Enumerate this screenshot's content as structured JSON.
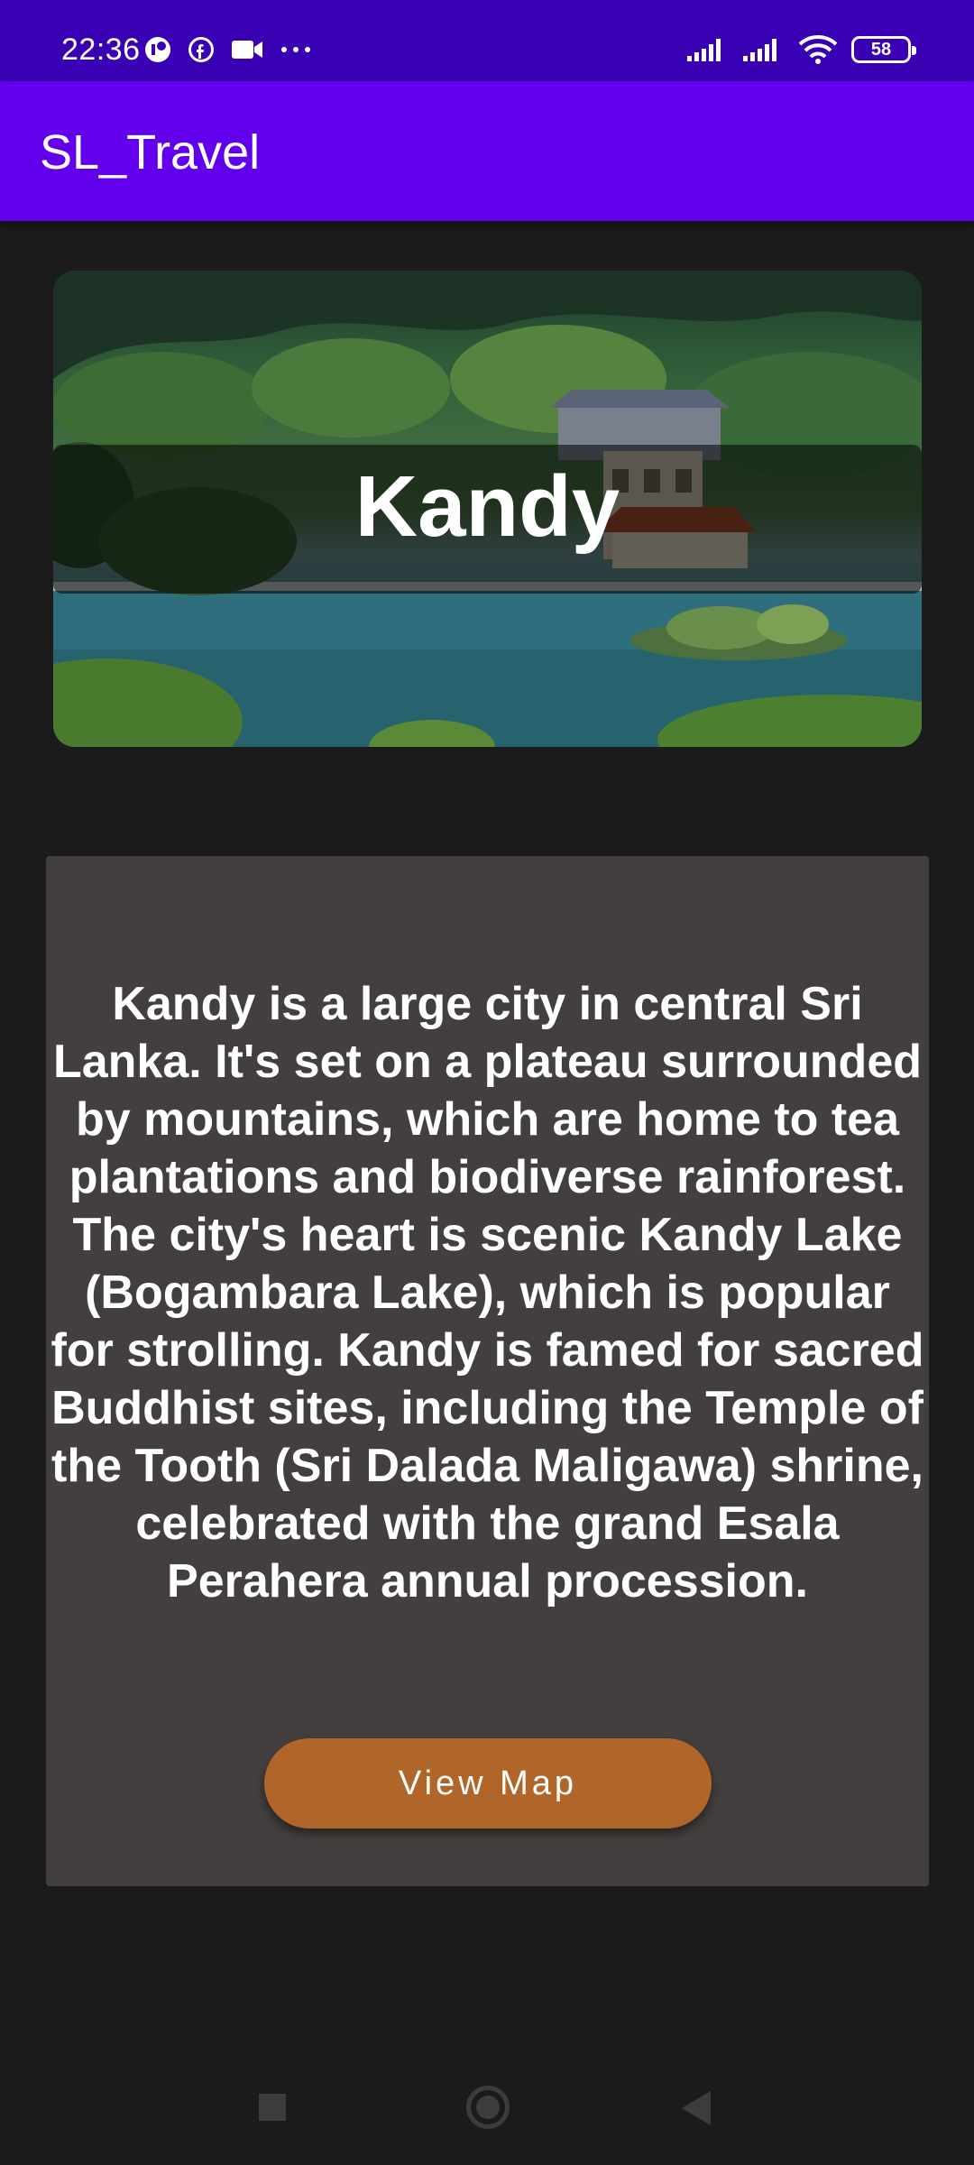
{
  "status_bar": {
    "time": "22:36",
    "battery": "58",
    "left_icons": [
      "app-notification-icon",
      "facebook-icon",
      "video-camera-icon",
      "more-dots-icon"
    ],
    "right_icons": [
      "signal-icon",
      "signal-icon",
      "wifi-icon",
      "battery-icon"
    ]
  },
  "app_bar": {
    "title": "SL_Travel",
    "color": "#6200ee"
  },
  "hero": {
    "title": "Kandy"
  },
  "card": {
    "description": "Kandy is a large city in central Sri Lanka. It's set on a plateau surrounded by mountains, which are home to tea plantations and biodiverse rainforest. The city's heart is scenic Kandy Lake (Bogambara Lake), which is popular for strolling. Kandy is famed for sacred Buddhist sites, including the Temple of the Tooth (Sri Dalada Maligawa) shrine, celebrated with the grand Esala Perahera annual procession.",
    "button_label": "View Map",
    "button_color": "#b06529"
  },
  "nav_bar": {
    "icons": [
      "recents-square-icon",
      "home-circle-icon",
      "back-triangle-icon"
    ]
  }
}
